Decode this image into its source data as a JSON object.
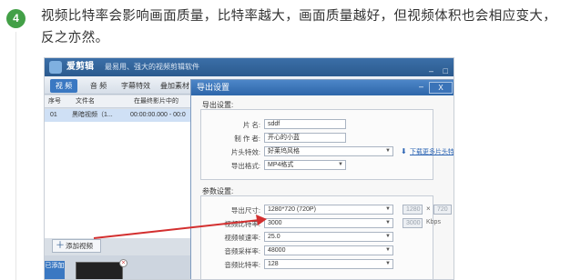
{
  "step": {
    "number": "4",
    "text": "视频比特率会影响画面质量，比特率越大，画面质量越好，但视频体积也会相应变大，反之亦然。"
  },
  "app": {
    "name": "爱剪辑",
    "slogan": "最易用、强大的视频剪辑软件",
    "tabs": [
      "视 频",
      "音 频",
      "字幕特效",
      "叠加素材"
    ],
    "list_headers": [
      "序号",
      "文件名",
      "在最终影片中的"
    ],
    "list_row": {
      "index": "01",
      "name": "黑暗视频（1...",
      "time": "00:00:00.000 - 00:0"
    },
    "add_video_label": "添加视频",
    "added_tag": "已添加"
  },
  "dialog": {
    "title": "导出设置",
    "close_label": "X",
    "export_group_title": "导出设置:",
    "fields": {
      "filename_label": "片    名:",
      "filename_value": "sddf",
      "producer_label": "制 作 者:",
      "producer_value": "开心的小蓝",
      "intro_label": "片头特效:",
      "intro_value": "好莱坞风格",
      "format_label": "导出格式:",
      "format_value": "MP4格式"
    },
    "download_link": "下载更多片头特效",
    "param_group_title": "参数设置:",
    "params": {
      "size_label": "导出尺寸:",
      "size_value": "1280*720 (720P)",
      "width_value": "1280",
      "height_value": "720",
      "vbitrate_label": "视频比特率:",
      "vbitrate_value": "3000",
      "vbitrate_custom": "3000",
      "vbitrate_unit": "Kbps",
      "fps_label": "视频帧速率:",
      "fps_value": "25.0",
      "asample_label": "音频采样率:",
      "asample_value": "48000",
      "abitrate_label": "音频比特率:",
      "abitrate_value": "128"
    }
  },
  "colors": {
    "badge": "#43a047",
    "arrow": "#d32f2f",
    "title_bar": "#2d66a9"
  }
}
